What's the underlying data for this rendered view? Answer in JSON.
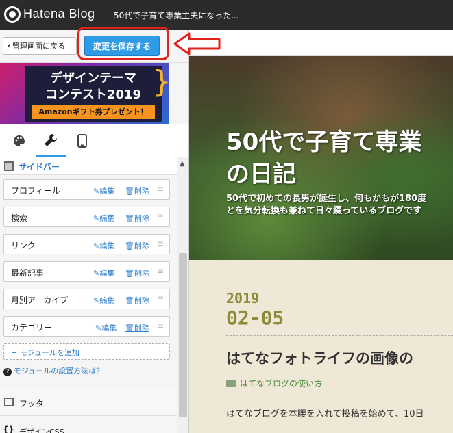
{
  "app": {
    "brand": "Hatena Blog",
    "blog_title": "50代で子育て専業主夫になった..."
  },
  "controls": {
    "back_label": "管理画面に戻る",
    "save_label": "変更を保存する"
  },
  "banner": {
    "line1": "デザインテーマ",
    "line2": "コンテスト2019",
    "line3": "Amazonギフト券プレゼント！"
  },
  "tabs": [
    {
      "name": "design",
      "icon": "palette-icon"
    },
    {
      "name": "customize",
      "icon": "wrench-icon"
    },
    {
      "name": "smartphone",
      "icon": "smartphone-icon"
    }
  ],
  "sidebar_section": {
    "title": "サイドバー"
  },
  "modules": [
    {
      "name": "プロフィール",
      "edit": "編集",
      "delete": "削除"
    },
    {
      "name": "検索",
      "edit": "編集",
      "delete": "削除"
    },
    {
      "name": "リンク",
      "edit": "編集",
      "delete": "削除"
    },
    {
      "name": "最新記事",
      "edit": "編集",
      "delete": "削除"
    },
    {
      "name": "月別アーカイブ",
      "edit": "編集",
      "delete": "削除"
    },
    {
      "name": "カテゴリー",
      "edit": "編集",
      "delete": "削除"
    }
  ],
  "add_module": "+ モジュールを追加",
  "how_to": "モジュールの設置方法は？",
  "footer_section": "フッタ",
  "css_section": "デザインCSS",
  "preview": {
    "title_line1": "50代で子育て専業",
    "title_line2": "の日記",
    "desc_line1": "50代で初めての長男が誕生し、何もかもが180度",
    "desc_line2": "とを気分転換も兼ねて日々綴っているブログです",
    "date_year": "2019",
    "date_md": "02-05",
    "post_title": "はてなフォトライフの画像の",
    "category": "はてなブログの使い方",
    "body": "はてなブログを本腰を入れて投稿を始めて、10日"
  },
  "colors": {
    "accent": "#2e9be6",
    "highlight": "#e0231f",
    "link": "#2e7ec9"
  }
}
